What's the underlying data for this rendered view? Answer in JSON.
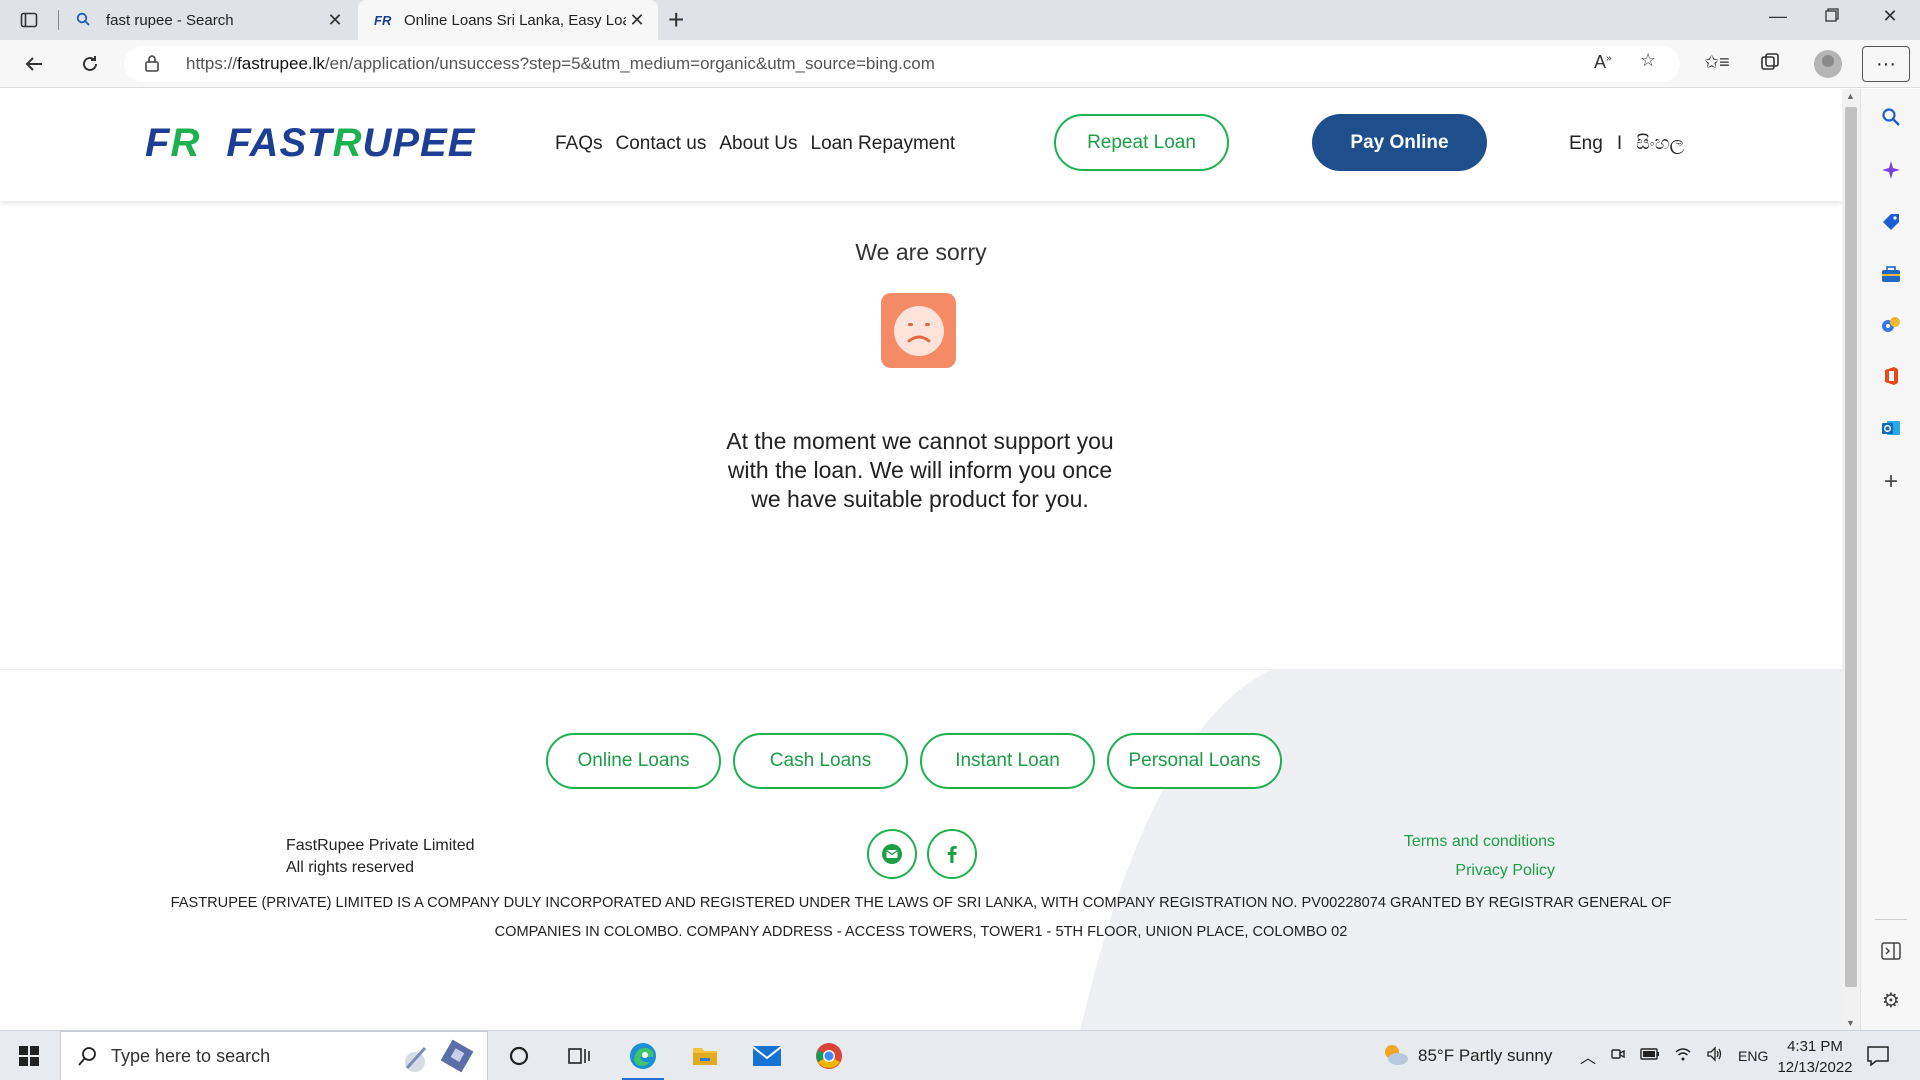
{
  "browser": {
    "tabs": [
      {
        "title": "fast rupee - Search",
        "favicon": "search-icon"
      },
      {
        "title": "Online Loans Sri Lanka, Easy Loans",
        "favicon": "fr-favicon",
        "favicon_text": "FR"
      }
    ],
    "url": {
      "prefix": "https://",
      "domain": "fastrupee.lk",
      "path": "/en/application/unsuccess?step=5&utm_medium=organic&utm_source=bing.com"
    }
  },
  "header": {
    "logo_mono_a": "F",
    "logo_mono_b": "R",
    "logo_word_a": "FAST",
    "logo_word_b": "R",
    "logo_word_c": "UPEE",
    "nav": [
      "FAQs",
      "Contact us",
      "About Us",
      "Loan Repayment"
    ],
    "repeat_loan": "Repeat Loan",
    "pay_online": "Pay Online",
    "lang_en": "Eng",
    "lang_sep": "I",
    "lang_si": "සිංහල"
  },
  "main": {
    "title": "We are sorry",
    "message": "At the moment we cannot support you with the loan. We will inform you once we have suitable product for you."
  },
  "footer": {
    "pills": [
      "Online Loans",
      "Cash Loans",
      "Instant Loan",
      "Personal Loans"
    ],
    "company_name": "FastRupee Private Limited",
    "rights": "All rights reserved",
    "terms": "Terms and conditions",
    "privacy": "Privacy Policy",
    "disclaimer_line1": "FASTRUPEE (PRIVATE) LIMITED IS A COMPANY DULY INCORPORATED AND REGISTERED UNDER THE LAWS OF SRI LANKA, WITH COMPANY REGISTRATION NO. PV00228074 GRANTED BY REGISTRAR GENERAL OF",
    "disclaimer_line2": "COMPANIES IN COLOMBO. COMPANY ADDRESS - ACCESS TOWERS, TOWER1 - 5TH FLOOR, UNION PLACE, COLOMBO 02"
  },
  "taskbar": {
    "search_placeholder": "Type here to search",
    "weather": "85°F  Partly sunny",
    "lang": "ENG",
    "time": "4:31 PM",
    "date": "12/13/2022"
  },
  "colors": {
    "brand_blue": "#1c3f95",
    "brand_green": "#1db24f",
    "pay_button": "#1f4e8c",
    "sad_face": "#f58a66"
  }
}
